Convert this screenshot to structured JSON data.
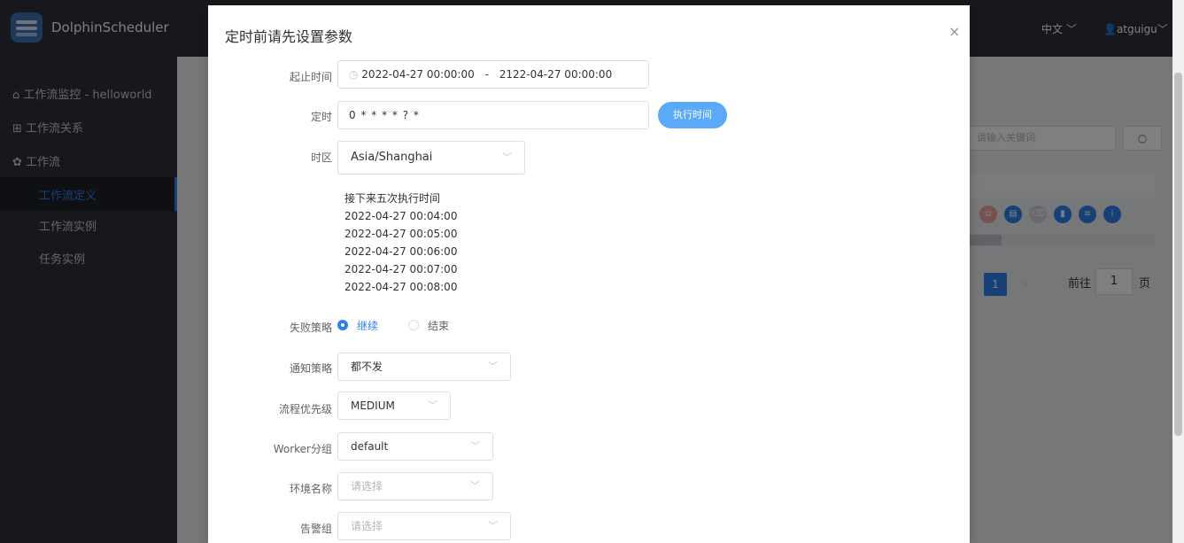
{
  "app": {
    "name": "DolphinScheduler",
    "language": "中文",
    "user": "atguigu"
  },
  "sidebar": {
    "items": [
      {
        "label": "工作流监控 - helloworld"
      },
      {
        "label": "工作流关系"
      },
      {
        "label": "工作流"
      }
    ],
    "sub_items": [
      {
        "label": "工作流定义",
        "active": true
      },
      {
        "label": "工作流实例"
      },
      {
        "label": "任务实例"
      }
    ]
  },
  "background": {
    "search_placeholder": "请输入关键词",
    "pagination": {
      "current": "1",
      "goto_label": "前往",
      "goto_value": "1",
      "page_label": "页"
    }
  },
  "modal": {
    "title": "定时前请先设置参数",
    "fields": {
      "date_range": {
        "label": "起止时间",
        "start": "2022-04-27 00:00:00",
        "separator": "-",
        "end": "2122-04-27 00:00:00"
      },
      "cron": {
        "label": "定时",
        "value": "0 * * * * ? *",
        "button": "执行时间"
      },
      "timezone": {
        "label": "时区",
        "value": "Asia/Shanghai"
      },
      "next_runs": {
        "title": "接下来五次执行时间",
        "times": [
          "2022-04-27 00:04:00",
          "2022-04-27 00:05:00",
          "2022-04-27 00:06:00",
          "2022-04-27 00:07:00",
          "2022-04-27 00:08:00"
        ]
      },
      "failure_strategy": {
        "label": "失败策略",
        "options": [
          {
            "label": "继续",
            "checked": true
          },
          {
            "label": "结束",
            "checked": false
          }
        ]
      },
      "notify_strategy": {
        "label": "通知策略",
        "value": "都不发"
      },
      "priority": {
        "label": "流程优先级",
        "value": "MEDIUM"
      },
      "worker_group": {
        "label": "Worker分组",
        "value": "default"
      },
      "environment": {
        "label": "环境名称",
        "placeholder": "请选择"
      },
      "alarm_group": {
        "label": "告警组",
        "placeholder": "请选择"
      }
    }
  },
  "colors": {
    "primary": "#2f80ed",
    "run_button": "#5aaaf8",
    "sidebar_bg": "#2d303a"
  }
}
